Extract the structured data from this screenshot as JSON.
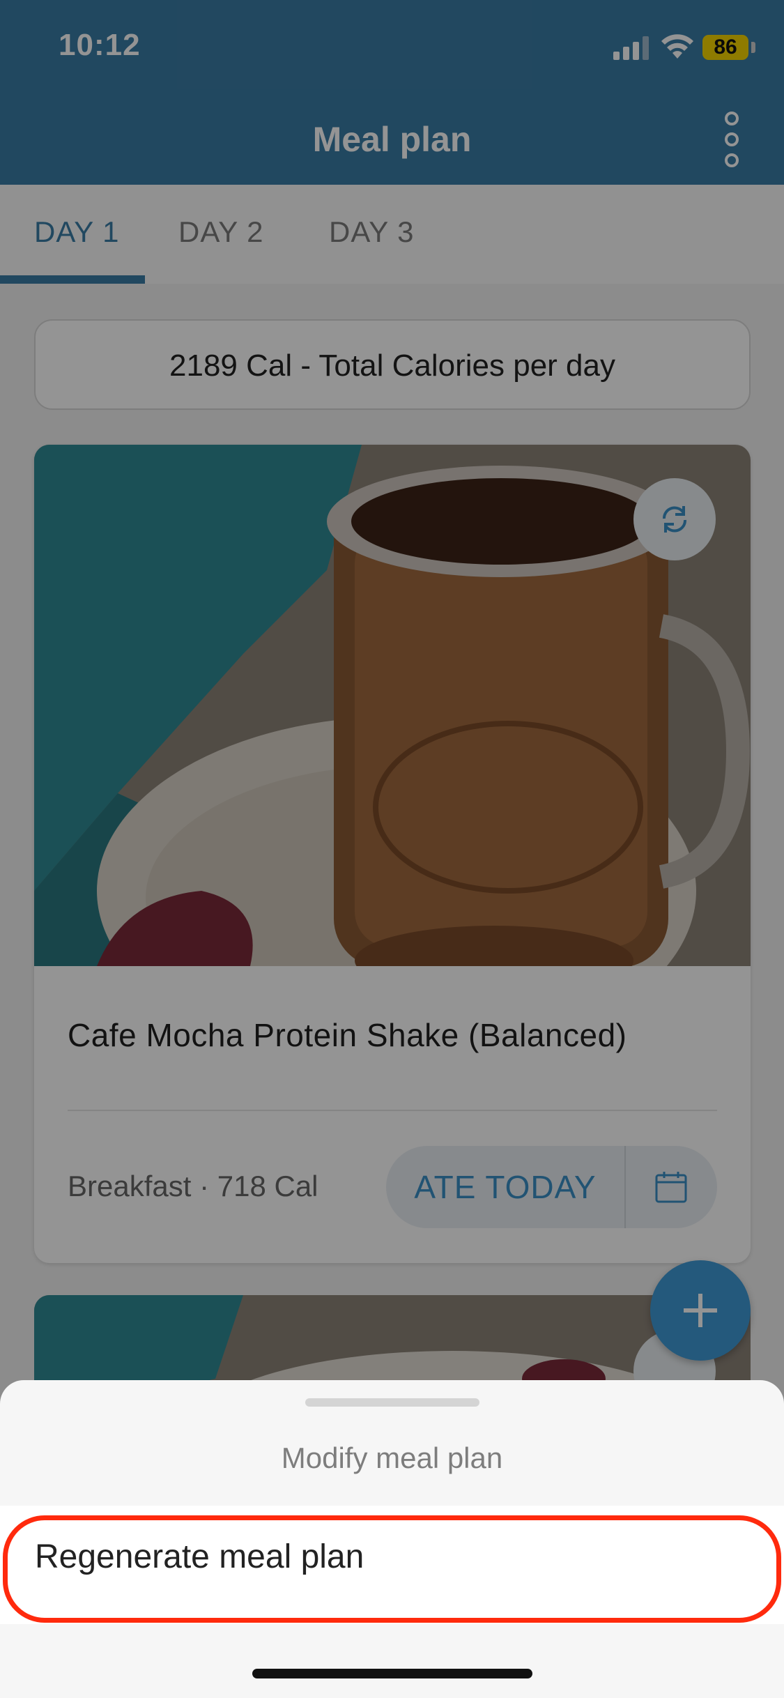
{
  "status_bar": {
    "time": "10:12",
    "battery": "86",
    "icons": [
      "cellular-signal-icon",
      "wifi-icon",
      "battery-icon"
    ]
  },
  "header": {
    "title": "Meal plan",
    "menu_icon": "more-vertical-icon"
  },
  "tabs": [
    {
      "label": "DAY 1",
      "active": true
    },
    {
      "label": "DAY 2",
      "active": false
    },
    {
      "label": "DAY 3",
      "active": false
    }
  ],
  "summary": {
    "text": "2189 Cal - Total Calories per day"
  },
  "meal_card": {
    "title": "Cafe Mocha Protein Shake (Balanced)",
    "meta": "Breakfast · 718 Cal",
    "ate_today_label": "ATE TODAY",
    "swap_icon": "swap-icon",
    "calendar_icon": "calendar-icon"
  },
  "fab": {
    "icon": "plus-icon"
  },
  "sheet": {
    "title": "Modify meal plan",
    "actions": [
      {
        "label": "Regenerate meal plan"
      }
    ]
  },
  "colors": {
    "brand": "#3a7ca6",
    "accent": "#3a8fc7",
    "fab": "#3f9ad6",
    "highlight": "#ff2a0d",
    "battery": "#f5d400"
  }
}
